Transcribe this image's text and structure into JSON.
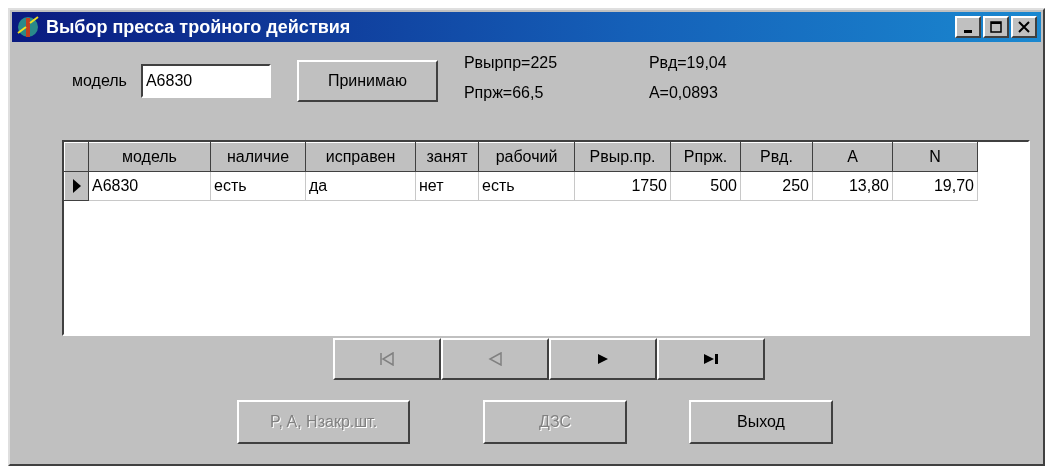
{
  "window": {
    "title": "Выбор пресса тройного действия"
  },
  "model_label": "модель",
  "model_field": {
    "value": "A6830"
  },
  "accept_button": {
    "label": "Принимаю",
    "disabled": false
  },
  "results": [
    {
      "text": "Рвырпр=225"
    },
    {
      "text": "Рвд=19,04"
    },
    {
      "text": "Рпрж=66,5"
    },
    {
      "text": "A=0,0893"
    }
  ],
  "table": {
    "columns": [
      {
        "label": "модель",
        "kind": "text"
      },
      {
        "label": "наличие",
        "kind": "text"
      },
      {
        "label": "исправен",
        "kind": "text"
      },
      {
        "label": "занят",
        "kind": "text"
      },
      {
        "label": "рабочий",
        "kind": "text"
      },
      {
        "label": "Рвыр.пр.",
        "kind": "number"
      },
      {
        "label": "Рпрж.",
        "kind": "number"
      },
      {
        "label": "Рвд.",
        "kind": "number"
      },
      {
        "label": "A",
        "kind": "number"
      },
      {
        "label": "N",
        "kind": "number"
      }
    ],
    "rows": [
      {
        "selected": true,
        "cells": [
          "A6830",
          "есть",
          "да",
          "нет",
          "есть",
          "1750",
          "500",
          "250",
          "13,80",
          "19,70"
        ]
      }
    ]
  },
  "navigator": [
    {
      "kind": "first",
      "disabled": true
    },
    {
      "kind": "prior",
      "disabled": true
    },
    {
      "kind": "next",
      "disabled": false
    },
    {
      "kind": "last",
      "disabled": false
    }
  ],
  "buttons": [
    {
      "label": "P, A, Нзакр.шт.",
      "disabled": true
    },
    {
      "label": "ДЗС",
      "disabled": true
    },
    {
      "label": "Выход",
      "disabled": false
    }
  ]
}
